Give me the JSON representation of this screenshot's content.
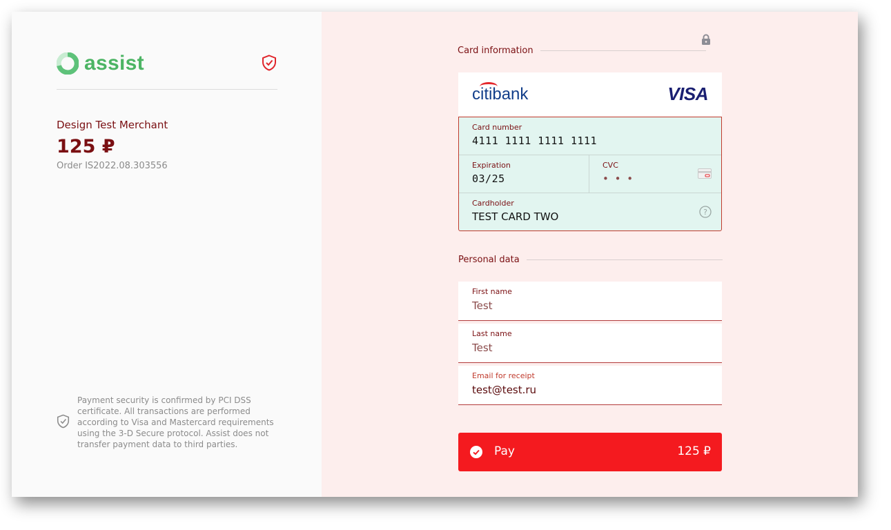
{
  "brand": {
    "name": "assist",
    "color": "#4cb464"
  },
  "merchant": {
    "name": "Design Test Merchant",
    "amount": "125 ₽",
    "order": "Order IS2022.08.303556"
  },
  "security_note": "Payment security is confirmed by PCI DSS certificate. All transactions are performed according to Visa and Mastercard requirements using the 3-D Secure protocol. Assist does not transfer payment data to third parties.",
  "card_section": {
    "title": "Card information",
    "bank_logo_left": "citi",
    "bank_logo_right": "bank",
    "network": "VISA",
    "card_number": {
      "label": "Card number",
      "value": "4111  1111  1111  1111"
    },
    "expiration": {
      "label": "Expiration",
      "value": "03/25"
    },
    "cvc": {
      "label": "CVC",
      "value": "• • •"
    },
    "cardholder": {
      "label": "Cardholder",
      "value": "TEST CARD TWO"
    }
  },
  "personal_section": {
    "title": "Personal data",
    "first_name": {
      "label": "First name",
      "value": "Test"
    },
    "last_name": {
      "label": "Last name",
      "value": "Test"
    },
    "email": {
      "label": "Email for receipt",
      "value": "test@test.ru"
    }
  },
  "pay_button": {
    "label": "Pay",
    "amount": "125 ₽",
    "color": "#f41a1f"
  },
  "colors": {
    "accent_dark_red": "#7a0f12",
    "right_bg": "#fdeeed",
    "card_fields_bg": "#e2f5f0"
  }
}
